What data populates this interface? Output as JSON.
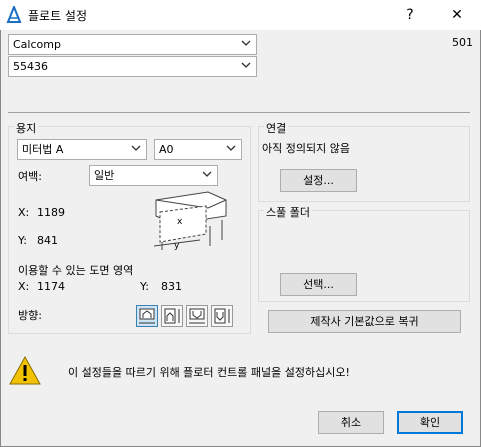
{
  "title": "플로트 설정",
  "help_label": "?",
  "close_label": "✕",
  "printer_select": "Calcomp",
  "model_select": "55436",
  "code": "501",
  "paper": {
    "group_label": "용지",
    "unit_select": "미터법 A",
    "size_select": "A0",
    "margin_label": "여백:",
    "margin_select": "일반",
    "x_label": "X:",
    "x_value": "1189",
    "y_label": "Y:",
    "y_value": "841",
    "printable_label": "이용할 수 있는 도면 영역",
    "px_label": "X:",
    "px_value": "1174",
    "py_label": "Y:",
    "py_value": "831",
    "orientation_label": "방향:"
  },
  "connection": {
    "group_label": "연결",
    "status": "아직 정의되지 않음",
    "setup_button": "설정..."
  },
  "spool": {
    "group_label": "스풀 폴더",
    "select_button": "선택..."
  },
  "reset_button": "제작사 기본값으로 복귀",
  "warning_text": "이 설정들을 따르기 위해 플로터 컨트롤 패널을 설정하십시오!",
  "cancel_button": "취소",
  "ok_button": "확인",
  "colors": {
    "accent": "#0078d7",
    "warning": "#f2c200"
  }
}
